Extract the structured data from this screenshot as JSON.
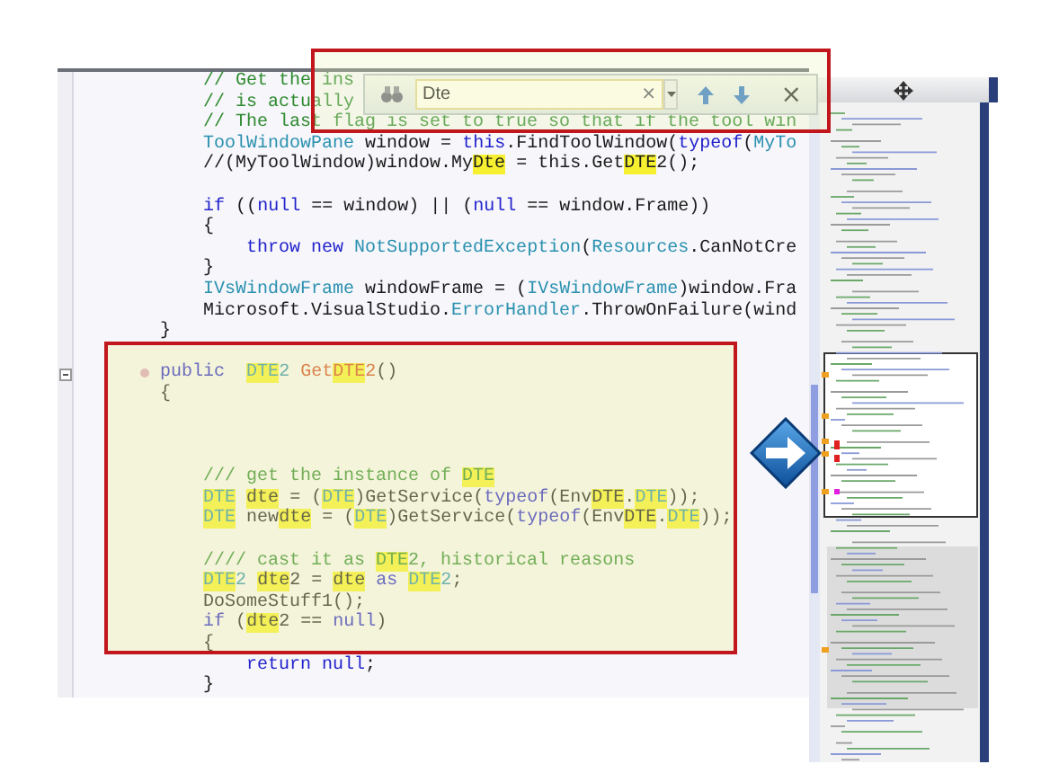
{
  "find_bar": {
    "value": "Dte",
    "clear": "×",
    "close": "×"
  },
  "editor": {
    "lines": [
      {
        "kind": "code",
        "tokens": [
          {
            "text": "            // Get the ins",
            "kind": "comment"
          }
        ]
      },
      {
        "kind": "code",
        "tokens": [
          {
            "text": "            // is actually",
            "kind": "comment"
          }
        ]
      },
      {
        "kind": "code",
        "tokens": [
          {
            "text": "            // The last flag is set to true so that if the tool win",
            "kind": "comment"
          }
        ]
      },
      {
        "kind": "code",
        "tokens": [
          {
            "text": "            ToolWindowPane",
            "kind": "type"
          },
          {
            "text": " window = ",
            "kind": "plain"
          },
          {
            "text": "this",
            "kind": "keyword"
          },
          {
            "text": ".FindToolWindow(",
            "kind": "plain"
          },
          {
            "text": "typeof",
            "kind": "keyword"
          },
          {
            "text": "(",
            "kind": "plain"
          },
          {
            "text": "MyTo",
            "kind": "type"
          }
        ]
      },
      {
        "kind": "code",
        "tokens": [
          {
            "text": "            //(MyToolWindow)window.My",
            "kind": "plain"
          },
          {
            "text": "Dte",
            "kind": "match-plain"
          },
          {
            "text": " = this.Get",
            "kind": "plain"
          },
          {
            "text": "DTE",
            "kind": "match-plain"
          },
          {
            "text": "2();",
            "kind": "plain"
          }
        ]
      },
      {
        "kind": "blank"
      },
      {
        "kind": "code",
        "tokens": [
          {
            "text": "            if",
            "kind": "keyword"
          },
          {
            "text": " ((",
            "kind": "plain"
          },
          {
            "text": "null",
            "kind": "keyword"
          },
          {
            "text": " == window) || (",
            "kind": "plain"
          },
          {
            "text": "null",
            "kind": "keyword"
          },
          {
            "text": " == window.Frame))",
            "kind": "plain"
          }
        ]
      },
      {
        "kind": "code",
        "tokens": [
          {
            "text": "            {",
            "kind": "plain"
          }
        ]
      },
      {
        "kind": "code",
        "tokens": [
          {
            "text": "                throw new",
            "kind": "keyword"
          },
          {
            "text": " NotSupportedException",
            "kind": "type"
          },
          {
            "text": "(",
            "kind": "plain"
          },
          {
            "text": "Resources",
            "kind": "type"
          },
          {
            "text": ".CanNotCre",
            "kind": "plain"
          }
        ]
      },
      {
        "kind": "code",
        "tokens": [
          {
            "text": "            }",
            "kind": "plain"
          }
        ]
      },
      {
        "kind": "code",
        "tokens": [
          {
            "text": "            IVsWindowFrame",
            "kind": "type"
          },
          {
            "text": " windowFrame = (",
            "kind": "plain"
          },
          {
            "text": "IVsWindowFrame",
            "kind": "type"
          },
          {
            "text": ")window.Fra",
            "kind": "plain"
          }
        ]
      },
      {
        "kind": "code",
        "tokens": [
          {
            "text": "            Microsoft.VisualStudio.",
            "kind": "plain"
          },
          {
            "text": "ErrorHandler",
            "kind": "type"
          },
          {
            "text": ".ThrowOnFailure(wind",
            "kind": "plain"
          }
        ]
      },
      {
        "kind": "code",
        "tokens": [
          {
            "text": "        }",
            "kind": "plain"
          }
        ]
      },
      {
        "kind": "blank"
      },
      {
        "kind": "member",
        "tokens": [
          {
            "text": "        public",
            "kind": "keyword"
          },
          {
            "text": "  DTE",
            "kind": "match-type"
          },
          {
            "text": "2",
            "kind": "type"
          },
          {
            "text": " Get",
            "kind": "method"
          },
          {
            "text": "DTE",
            "kind": "match-method"
          },
          {
            "text": "2",
            "kind": "method"
          },
          {
            "text": "()",
            "kind": "plain"
          }
        ]
      },
      {
        "kind": "code",
        "tokens": [
          {
            "text": "        {",
            "kind": "plain"
          }
        ]
      },
      {
        "kind": "blank"
      },
      {
        "kind": "blank"
      },
      {
        "kind": "blank"
      },
      {
        "kind": "code",
        "tokens": [
          {
            "text": "            /// get the instance of ",
            "kind": "comment"
          },
          {
            "text": "DTE",
            "kind": "match-comment"
          }
        ]
      },
      {
        "kind": "code",
        "tokens": [
          {
            "text": "            DTE",
            "kind": "match-type"
          },
          {
            "text": " dte",
            "kind": "match-plain"
          },
          {
            "text": " = (",
            "kind": "plain"
          },
          {
            "text": "DTE",
            "kind": "match-type"
          },
          {
            "text": ")GetService(",
            "kind": "plain"
          },
          {
            "text": "typeof",
            "kind": "keyword"
          },
          {
            "text": "(Env",
            "kind": "plain"
          },
          {
            "text": "DTE",
            "kind": "match-plain"
          },
          {
            "text": ".",
            "kind": "plain"
          },
          {
            "text": "DTE",
            "kind": "match-type"
          },
          {
            "text": "));",
            "kind": "plain"
          }
        ]
      },
      {
        "kind": "code",
        "tokens": [
          {
            "text": "            DTE",
            "kind": "match-type"
          },
          {
            "text": " new",
            "kind": "plain"
          },
          {
            "text": "dte",
            "kind": "match-plain"
          },
          {
            "text": " = (",
            "kind": "plain"
          },
          {
            "text": "DTE",
            "kind": "match-type"
          },
          {
            "text": ")GetService(",
            "kind": "plain"
          },
          {
            "text": "typeof",
            "kind": "keyword"
          },
          {
            "text": "(Env",
            "kind": "plain"
          },
          {
            "text": "DTE",
            "kind": "match-plain"
          },
          {
            "text": ".",
            "kind": "plain"
          },
          {
            "text": "DTE",
            "kind": "match-type"
          },
          {
            "text": "));",
            "kind": "plain"
          }
        ]
      },
      {
        "kind": "blank"
      },
      {
        "kind": "code",
        "tokens": [
          {
            "text": "            //// cast it as ",
            "kind": "comment"
          },
          {
            "text": "DTE",
            "kind": "match-comment"
          },
          {
            "text": "2, historical reasons",
            "kind": "comment"
          }
        ]
      },
      {
        "kind": "code",
        "tokens": [
          {
            "text": "            DTE",
            "kind": "match-type"
          },
          {
            "text": "2",
            "kind": "type"
          },
          {
            "text": " dte",
            "kind": "match-plain"
          },
          {
            "text": "2 = ",
            "kind": "plain"
          },
          {
            "text": "dte",
            "kind": "match-plain"
          },
          {
            "text": " as",
            "kind": "keyword"
          },
          {
            "text": " DTE",
            "kind": "match-type"
          },
          {
            "text": "2",
            "kind": "type"
          },
          {
            "text": ";",
            "kind": "plain"
          }
        ]
      },
      {
        "kind": "code",
        "tokens": [
          {
            "text": "            DoSomeStuff1();",
            "kind": "plain"
          }
        ]
      },
      {
        "kind": "code",
        "tokens": [
          {
            "text": "            if",
            "kind": "keyword"
          },
          {
            "text": " (",
            "kind": "plain"
          },
          {
            "text": "dte",
            "kind": "match-plain"
          },
          {
            "text": "2 == ",
            "kind": "plain"
          },
          {
            "text": "null",
            "kind": "keyword"
          },
          {
            "text": ")",
            "kind": "plain"
          }
        ]
      },
      {
        "kind": "code",
        "tokens": [
          {
            "text": "            {",
            "kind": "plain"
          }
        ]
      },
      {
        "kind": "code",
        "tokens": [
          {
            "text": "                return null",
            "kind": "keyword"
          },
          {
            "text": ";",
            "kind": "plain"
          }
        ]
      },
      {
        "kind": "code",
        "tokens": [
          {
            "text": "            }",
            "kind": "plain"
          }
        ]
      }
    ]
  }
}
